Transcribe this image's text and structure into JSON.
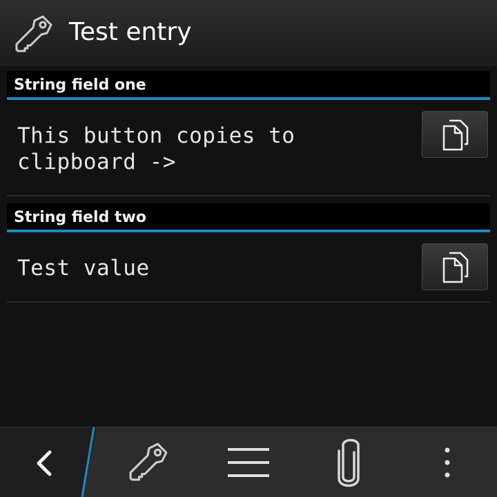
{
  "window": {
    "title": "Test entry",
    "title_icon": "key-icon"
  },
  "fields": [
    {
      "label": "String field one",
      "value": "This button copies to\nclipboard ->",
      "action_icon": "copy-icon"
    },
    {
      "label": "String field two",
      "value": "Test value",
      "action_icon": "copy-icon"
    }
  ],
  "action_bar": {
    "items": [
      {
        "icon": "back-icon"
      },
      {
        "icon": "key-icon"
      },
      {
        "icon": "menu-icon"
      },
      {
        "icon": "paperclip-icon"
      },
      {
        "icon": "overflow-menu-icon"
      }
    ]
  },
  "colors": {
    "accent": "#1a8cc4",
    "background": "#121212",
    "header_bg": "#000000"
  }
}
